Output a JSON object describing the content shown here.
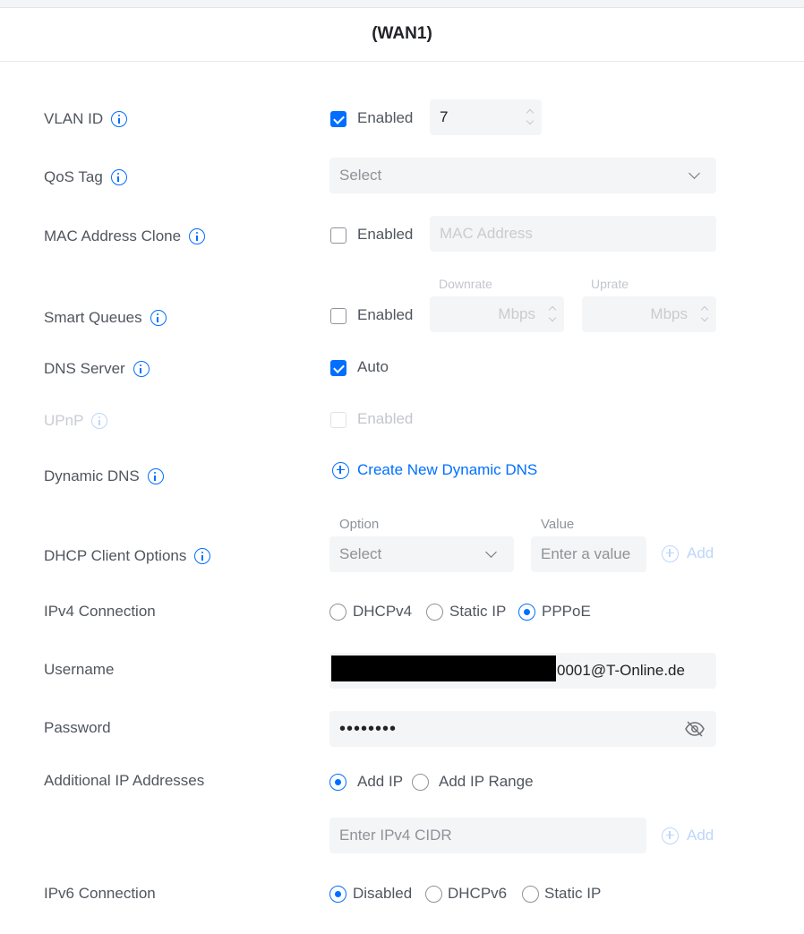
{
  "header": {
    "title": "(WAN1)"
  },
  "vlan": {
    "label": "VLAN ID",
    "enabled_label": "Enabled",
    "value": "7"
  },
  "qos": {
    "label": "QoS Tag",
    "placeholder": "Select"
  },
  "mac": {
    "label": "MAC Address Clone",
    "enabled_label": "Enabled",
    "placeholder": "MAC Address"
  },
  "smart_queues": {
    "label": "Smart Queues",
    "enabled_label": "Enabled",
    "downrate_label": "Downrate",
    "uprate_label": "Uprate",
    "downrate_unit": "Mbps",
    "uprate_unit": "Mbps"
  },
  "dns": {
    "label": "DNS Server",
    "auto_label": "Auto"
  },
  "upnp": {
    "label": "UPnP",
    "enabled_label": "Enabled"
  },
  "ddns": {
    "label": "Dynamic DNS",
    "create_label": "Create New Dynamic DNS"
  },
  "dhcp_options": {
    "label": "DHCP Client Options",
    "option_label": "Option",
    "value_label": "Value",
    "option_placeholder": "Select",
    "value_placeholder": "Enter a value",
    "add_label": "Add"
  },
  "ipv4": {
    "label": "IPv4 Connection",
    "options": [
      "DHCPv4",
      "Static IP",
      "PPPoE"
    ],
    "selected": "PPPoE"
  },
  "username": {
    "label": "Username",
    "visible_suffix": "0001@T-Online.de"
  },
  "password": {
    "label": "Password",
    "masked": "••••••••"
  },
  "additional_ip": {
    "label": "Additional IP Addresses",
    "options": [
      "Add IP",
      "Add IP Range"
    ],
    "selected": "Add IP",
    "placeholder": "Enter IPv4 CIDR",
    "add_label": "Add"
  },
  "ipv6": {
    "label": "IPv6 Connection",
    "options": [
      "Disabled",
      "DHCPv6",
      "Static IP"
    ],
    "selected": "Disabled"
  },
  "colors": {
    "accent": "#006fff",
    "text": "#50565e",
    "field_bg": "#f4f5f6"
  }
}
